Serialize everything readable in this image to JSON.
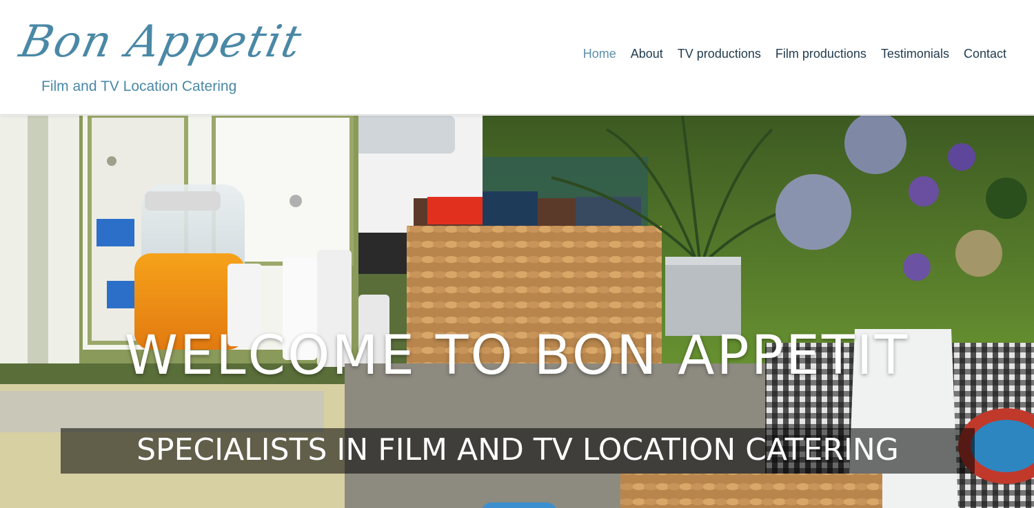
{
  "brand": {
    "name": "Bon Appetit",
    "tagline": "Film and TV Location Catering",
    "color": "#4a88a6"
  },
  "nav": {
    "items": [
      {
        "label": "Home",
        "active": true
      },
      {
        "label": "About",
        "active": false
      },
      {
        "label": "TV productions",
        "active": false
      },
      {
        "label": "Film productions",
        "active": false
      },
      {
        "label": "Testimonials",
        "active": false
      },
      {
        "label": "Contact",
        "active": false
      }
    ],
    "active_color": "#5b8ea8",
    "text_color": "#1f3a4d"
  },
  "hero": {
    "title": "WELCOME TO BON APPETIT",
    "subtitle": "SPECIALISTS IN FILM AND TV LOCATION CATERING"
  }
}
